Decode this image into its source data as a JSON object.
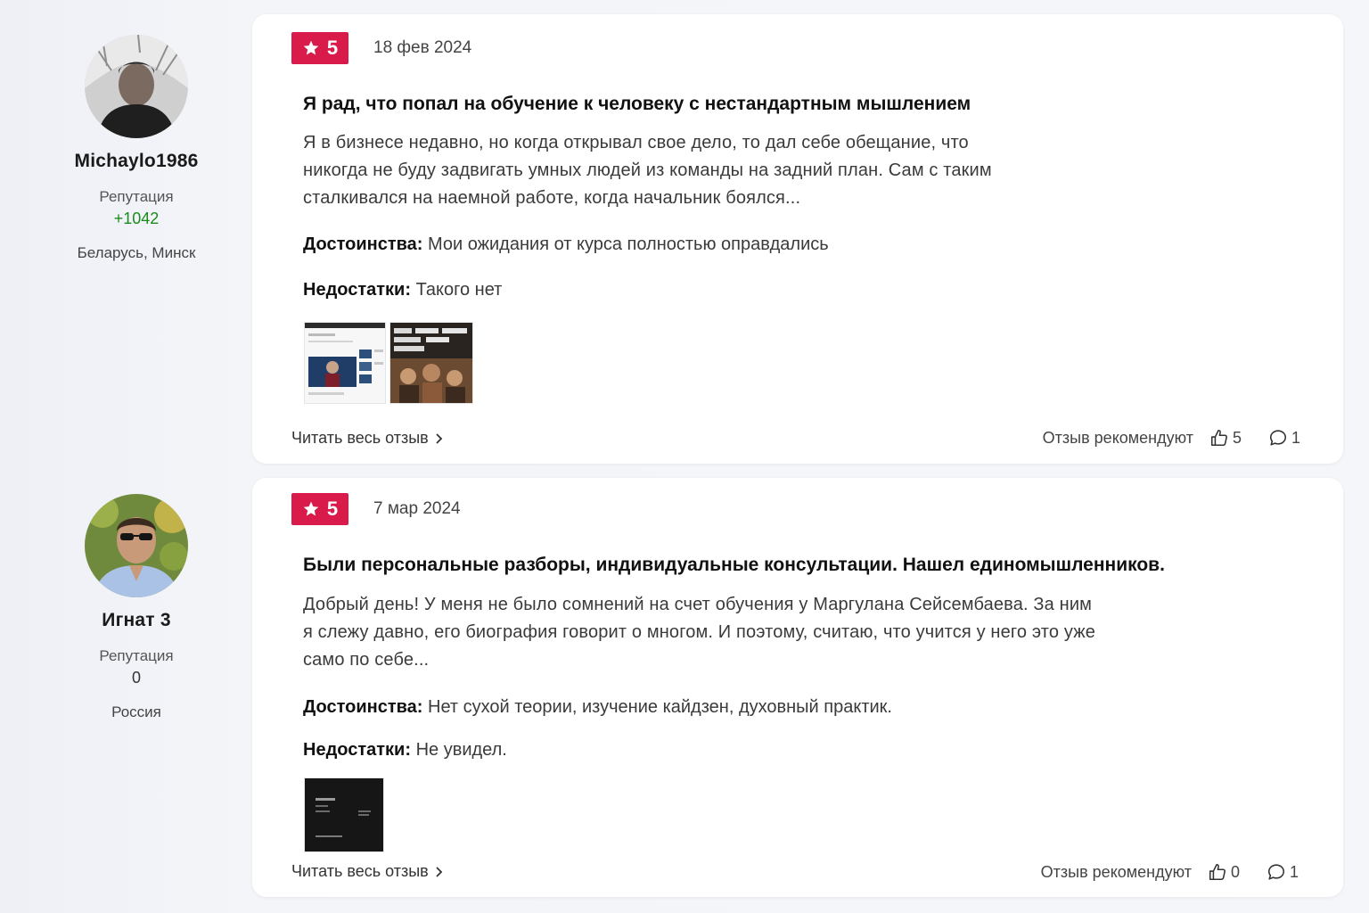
{
  "labels": {
    "reputation": "Репутация",
    "pros": "Достоинства:",
    "cons": "Недостатки:",
    "read_more": "Читать весь отзыв",
    "recommend": "Отзыв рекомендуют"
  },
  "reviews": [
    {
      "author": {
        "name": "Michaylo1986",
        "reputation": "+1042",
        "location": "Беларусь, Минск"
      },
      "rating": "5",
      "date": "18 фев 2024",
      "title": "Я рад, что попал на обучение к человеку с нестандартным мышлением",
      "body": "Я в бизнесе недавно, но когда открывал свое дело, то дал себе обещание, что никогда не буду задвигать умных людей из команды на задний план. Сам с таким сталкивался на наемной работе, когда начальник боялся...",
      "pros": "Мои ожидания от курса полностью оправдались",
      "cons": "Такого нет",
      "likes": "5",
      "comments": "1"
    },
    {
      "author": {
        "name": "Игнат 3",
        "reputation": "0",
        "location": "Россия"
      },
      "rating": "5",
      "date": "7 мар 2024",
      "title": "Были персональные разборы, индивидуальные консультации. Нашел единомышленников.",
      "body": "Добрый день! У меня не было сомнений на счет обучения у Маргулана Сейсембаева. За ним я слежу давно, его биография говорит о многом. И поэтому, считаю, что учится у него это уже само по себе...",
      "pros": "Нет сухой теории, изучение кайдзен, духовный практик.",
      "cons": "Не увидел.",
      "likes": "0",
      "comments": "1"
    }
  ],
  "colors": {
    "rating_badge": "#d81b4a",
    "reputation_positive": "#1a8c1a",
    "card_background": "#ffffff",
    "page_background": "#f4f5f9"
  },
  "icons": {
    "rating": "star-icon",
    "read_more": "chevron-right-icon",
    "likes": "thumbs-up-icon",
    "comments": "comment-bubble-icon"
  }
}
